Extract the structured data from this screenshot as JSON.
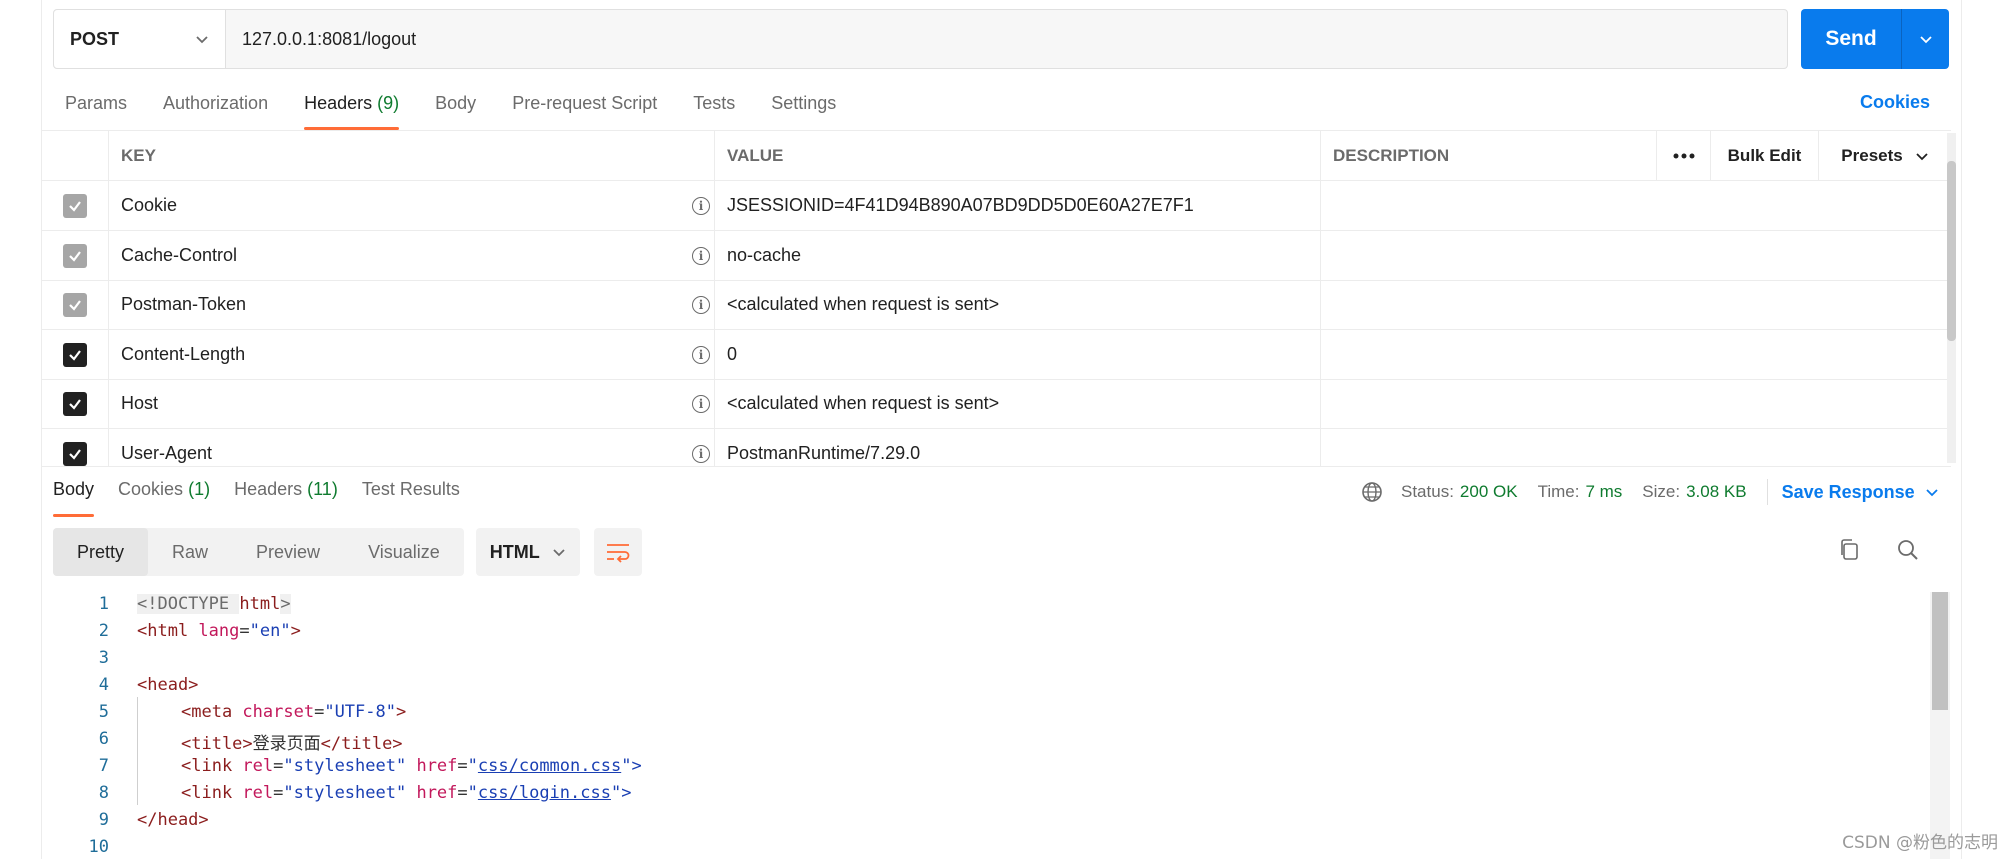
{
  "request": {
    "method": "POST",
    "url": "127.0.0.1:8081/logout",
    "send_label": "Send"
  },
  "request_tabs": [
    {
      "label": "Params",
      "count": ""
    },
    {
      "label": "Authorization",
      "count": ""
    },
    {
      "label": "Headers",
      "count": "(9)"
    },
    {
      "label": "Body",
      "count": ""
    },
    {
      "label": "Pre-request Script",
      "count": ""
    },
    {
      "label": "Tests",
      "count": ""
    },
    {
      "label": "Settings",
      "count": ""
    }
  ],
  "cookies_link": "Cookies",
  "headers_table": {
    "columns": {
      "key": "KEY",
      "value": "VALUE",
      "description": "DESCRIPTION"
    },
    "more_label": "ooo",
    "bulk_edit": "Bulk Edit",
    "presets": "Presets",
    "rows": [
      {
        "key": "Cookie",
        "value": "JSESSIONID=4F41D94B890A07BD9DD5D0E60A27E7F1",
        "checked_style": "grey"
      },
      {
        "key": "Cache-Control",
        "value": "no-cache",
        "checked_style": "grey"
      },
      {
        "key": "Postman-Token",
        "value": "<calculated when request is sent>",
        "checked_style": "grey"
      },
      {
        "key": "Content-Length",
        "value": "0",
        "checked_style": "dark"
      },
      {
        "key": "Host",
        "value": "<calculated when request is sent>",
        "checked_style": "dark"
      },
      {
        "key": "User-Agent",
        "value": "PostmanRuntime/7.29.0",
        "checked_style": "dark"
      }
    ]
  },
  "response": {
    "tabs": [
      {
        "label": "Body",
        "count": ""
      },
      {
        "label": "Cookies",
        "count": "(1)"
      },
      {
        "label": "Headers",
        "count": "(11)"
      },
      {
        "label": "Test Results",
        "count": ""
      }
    ],
    "status_label": "Status:",
    "status_value": "200 OK",
    "time_label": "Time:",
    "time_value": "7 ms",
    "size_label": "Size:",
    "size_value": "3.08 KB",
    "save_response": "Save Response",
    "view_modes": [
      "Pretty",
      "Raw",
      "Preview",
      "Visualize"
    ],
    "format": "HTML"
  },
  "code": {
    "line_numbers": [
      "1",
      "2",
      "3",
      "4",
      "5",
      "6",
      "7",
      "8",
      "9",
      "10"
    ],
    "line1": {
      "open": "<!DOCTYPE ",
      "name": "html",
      "close": ">"
    },
    "line2": {
      "tag_open": "<html ",
      "attr": "lang",
      "eq": "=",
      "val": "\"en\"",
      "end": ">"
    },
    "line4": "<head>",
    "line5": {
      "tag_open": "<meta ",
      "attr": "charset",
      "eq": "=",
      "val": "\"UTF-8\"",
      "end": ">"
    },
    "line6": {
      "open": "<title>",
      "text": "登录页面",
      "close": "</title>"
    },
    "line7": {
      "tag_open": "<link ",
      "attr1": "rel",
      "eq": "=",
      "val1": "\"stylesheet\"",
      "attr2": " href",
      "q": "\"",
      "href": "css/common.css",
      "end": "\">"
    },
    "line8": {
      "tag_open": "<link ",
      "attr1": "rel",
      "eq": "=",
      "val1": "\"stylesheet\"",
      "attr2": " href",
      "q": "\"",
      "href": "css/login.css",
      "end": "\">"
    },
    "line9": "</head>"
  },
  "watermark": "CSDN @粉色的志明",
  "colors": {
    "accent": "#ff6c37",
    "primary": "#097bed",
    "success": "#0f7b2f"
  }
}
